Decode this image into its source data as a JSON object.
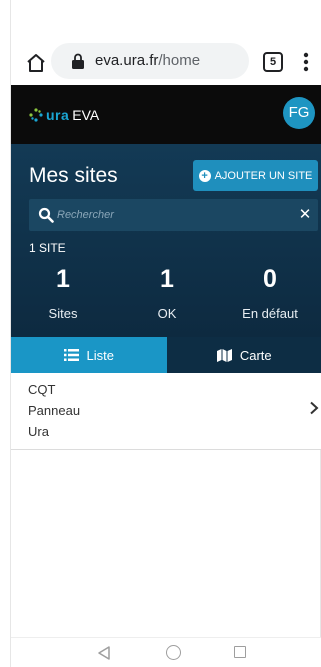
{
  "browser": {
    "url_host": "eva.ura.fr",
    "url_path": "/home",
    "tab_count": "5"
  },
  "app": {
    "logo_ura": "ura",
    "logo_eva": "EVA",
    "avatar_initials": "FG"
  },
  "panel": {
    "title": "Mes sites",
    "add_button_label": "AJOUTER UN SITE",
    "search_placeholder": "Rechercher",
    "search_value": "",
    "site_count_label": "1 SITE",
    "stats": [
      {
        "value": "1",
        "label": "Sites"
      },
      {
        "value": "1",
        "label": "OK"
      },
      {
        "value": "0",
        "label": "En défaut"
      }
    ]
  },
  "tabs": [
    {
      "label": "Liste",
      "icon": "list-icon",
      "active": true
    },
    {
      "label": "Carte",
      "icon": "map-icon",
      "active": false
    }
  ],
  "sites": [
    {
      "lines": [
        "CQT",
        "Panneau",
        "Ura"
      ]
    }
  ],
  "colors": {
    "header_bg": "#0b0b0b",
    "panel_bg": "#133a55",
    "accent": "#1f8fbd",
    "active_tab": "#1a96c6",
    "inactive_tab": "#0d2d44"
  }
}
